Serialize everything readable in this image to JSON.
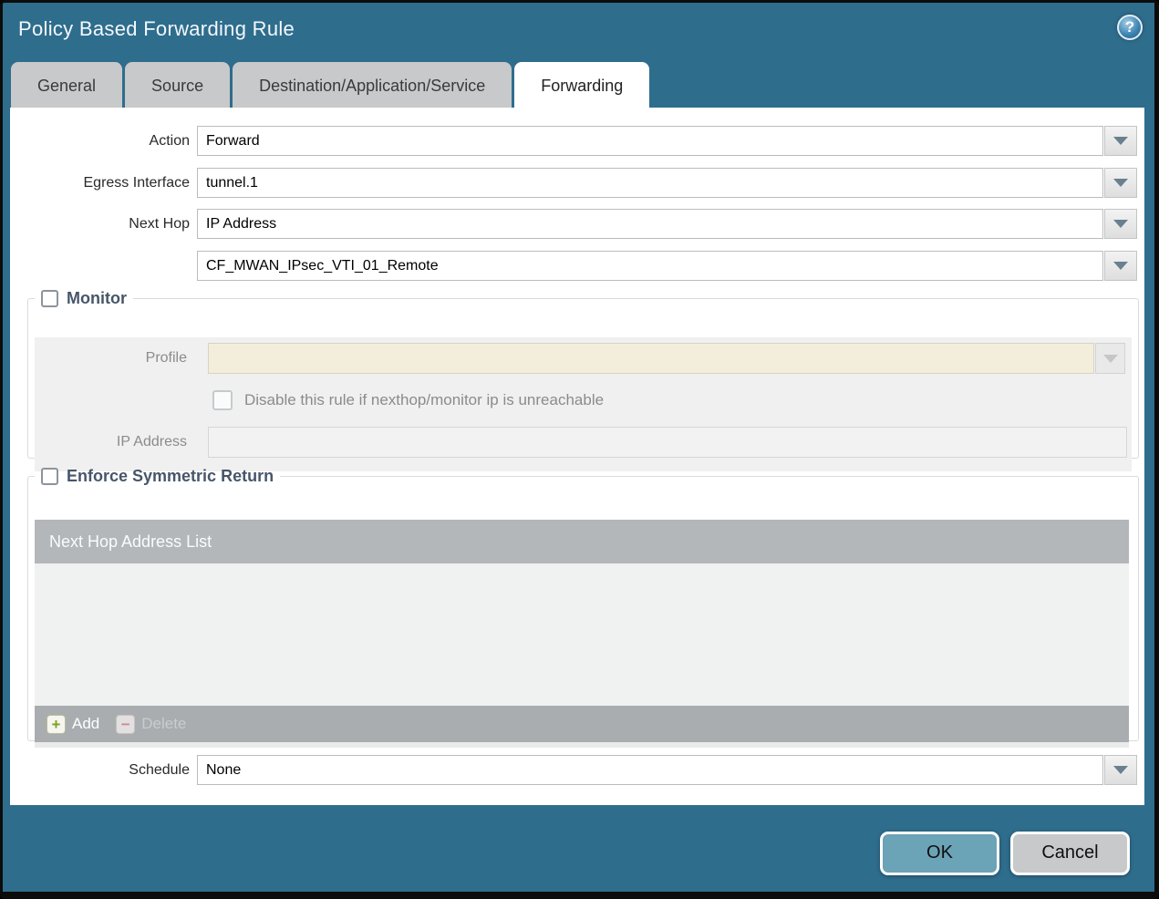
{
  "dialog": {
    "title": "Policy Based Forwarding Rule"
  },
  "icons": {
    "help": "?",
    "add": "+",
    "delete": "−"
  },
  "tabs": {
    "general": "General",
    "source": "Source",
    "destination": "Destination/Application/Service",
    "forwarding": "Forwarding"
  },
  "form": {
    "action_label": "Action",
    "action_value": "Forward",
    "egress_label": "Egress Interface",
    "egress_value": "tunnel.1",
    "next_hop_label": "Next Hop",
    "next_hop_value": "IP Address",
    "next_hop_address_value": "CF_MWAN_IPsec_VTI_01_Remote",
    "schedule_label": "Schedule",
    "schedule_value": "None"
  },
  "monitor": {
    "legend": "Monitor",
    "checked": false,
    "profile_label": "Profile",
    "profile_value": "",
    "disable_rule_label": "Disable this rule if nexthop/monitor ip is unreachable",
    "disable_rule_checked": false,
    "ip_address_label": "IP Address",
    "ip_address_value": ""
  },
  "symmetric_return": {
    "legend": "Enforce Symmetric Return",
    "checked": false,
    "table_header": "Next Hop Address List",
    "rows": [],
    "add_label": "Add",
    "delete_label": "Delete"
  },
  "footer": {
    "ok_label": "OK",
    "cancel_label": "Cancel"
  },
  "theme": {
    "frame_teal": "#2f6d8d",
    "ok_button": "#6ba3b7",
    "cancel_button": "#c7c9ca",
    "disabled_profile_field": "#f3eedb",
    "table_header_gray": "#b3b7ba",
    "table_footer_gray": "#a9adb0",
    "legend_text": "#47566a",
    "add_plus_green": "#7da120",
    "delete_minus_red": "#d2838b"
  }
}
